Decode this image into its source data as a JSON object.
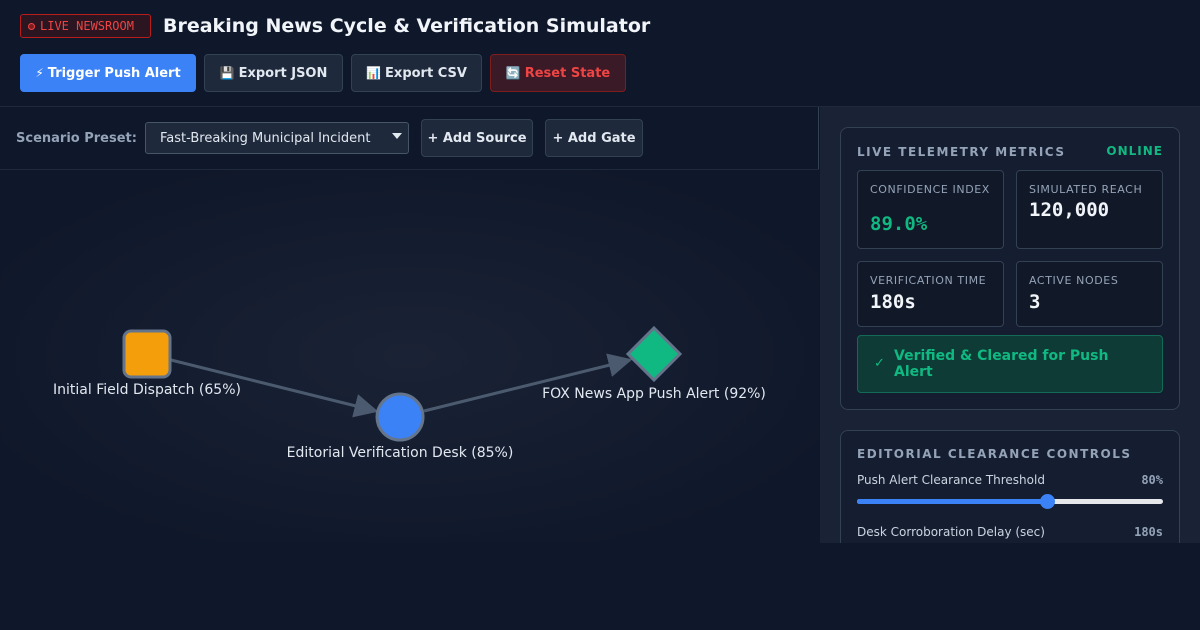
{
  "header": {
    "badge": "LIVE NEWSROOM",
    "title": "Breaking News Cycle & Verification Simulator",
    "buttons": {
      "trigger": {
        "icon": "⚡",
        "label": "Trigger Push Alert"
      },
      "export_json": {
        "icon": "💾",
        "label": "Export JSON"
      },
      "export_csv": {
        "icon": "📊",
        "label": "Export CSV"
      },
      "reset": {
        "icon": "🔄",
        "label": "Reset State"
      }
    }
  },
  "toolbar": {
    "preset_label": "Scenario Preset:",
    "preset_value": "Fast-Breaking Municipal Incident",
    "add_source": "+ Add Source",
    "add_gate": "+ Add Gate"
  },
  "graph": {
    "nodes": [
      {
        "label": "Initial Field Dispatch (65%)",
        "shape": "square",
        "color": "#f59e0b"
      },
      {
        "label": "Editorial Verification Desk (85%)",
        "shape": "circle",
        "color": "#3b82f6"
      },
      {
        "label": "FOX News App Push Alert (92%)",
        "shape": "diamond",
        "color": "#10b981"
      }
    ]
  },
  "telemetry": {
    "title": "LIVE TELEMETRY METRICS",
    "status": "ONLINE",
    "confidence_label": "CONFIDENCE INDEX",
    "confidence_value": "89.0%",
    "reach_label": "SIMULATED REACH",
    "reach_value": "120,000",
    "verification_label": "VERIFICATION TIME",
    "verification_value": "180s",
    "nodes_label": "ACTIVE NODES",
    "nodes_value": "3",
    "clearance_icon": "✓",
    "clearance_text": "Verified & Cleared for Push Alert"
  },
  "controls": {
    "title": "EDITORIAL CLEARANCE CONTROLS",
    "threshold_label": "Push Alert Clearance Threshold",
    "threshold_value": "80%",
    "threshold_fraction": 0.62,
    "delay_label": "Desk Corroboration Delay (sec)",
    "delay_value": "180s"
  },
  "colors": {
    "accent": "#3b82f6",
    "success": "#10b981",
    "danger": "#ef4444",
    "warning": "#f59e0b"
  }
}
